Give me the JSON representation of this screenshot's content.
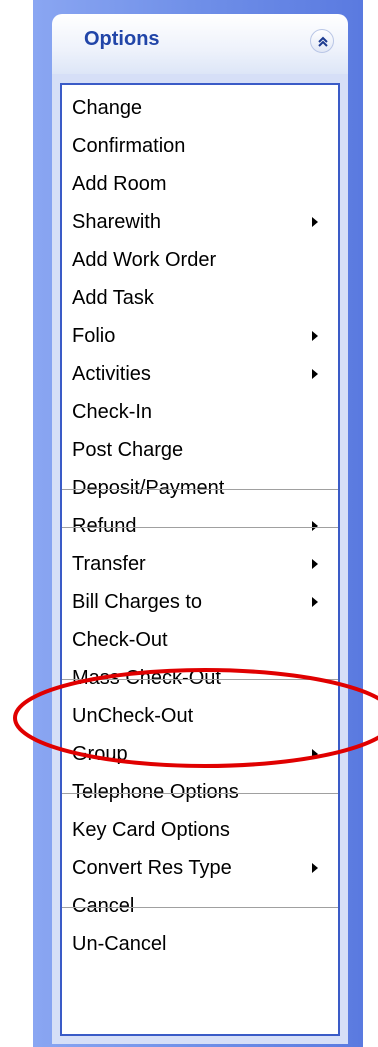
{
  "panel": {
    "title": "Options",
    "collapse_icon": "double-chevron-up-icon",
    "accent_color": "#2145a8",
    "border_color": "#3a5bc7"
  },
  "menu": {
    "items": [
      {
        "label": "Change",
        "submenu": false
      },
      {
        "label": "Confirmation",
        "submenu": false
      },
      {
        "label": "Add Room",
        "submenu": false
      },
      {
        "label": "Sharewith",
        "submenu": true
      },
      {
        "label": "Add Work Order",
        "submenu": false
      },
      {
        "label": "Add Task",
        "submenu": false
      },
      {
        "label": "Folio",
        "submenu": true
      },
      {
        "label": "Activities",
        "submenu": true
      },
      {
        "label": "Check-In",
        "submenu": false
      },
      {
        "label": "Post Charge",
        "submenu": false
      },
      {
        "label": "Deposit/Payment",
        "submenu": false
      },
      {
        "label": "Refund",
        "submenu": true
      },
      {
        "label": "Transfer",
        "submenu": true
      },
      {
        "label": "Bill Charges to",
        "submenu": true
      },
      {
        "label": "Check-Out",
        "submenu": false
      },
      {
        "label": "Mass Check-Out",
        "submenu": false
      },
      {
        "label": "UnCheck-Out",
        "submenu": false
      },
      {
        "label": "Group",
        "submenu": true
      },
      {
        "label": "Telephone Options",
        "submenu": false
      },
      {
        "label": "Key Card Options",
        "submenu": false
      },
      {
        "label": "Convert Res Type",
        "submenu": true
      },
      {
        "label": "Cancel",
        "submenu": false
      },
      {
        "label": "Un-Cancel",
        "submenu": false
      }
    ]
  },
  "annotation": {
    "shape": "ellipse",
    "color": "#e00000",
    "target_label": "Mass Check-Out"
  }
}
